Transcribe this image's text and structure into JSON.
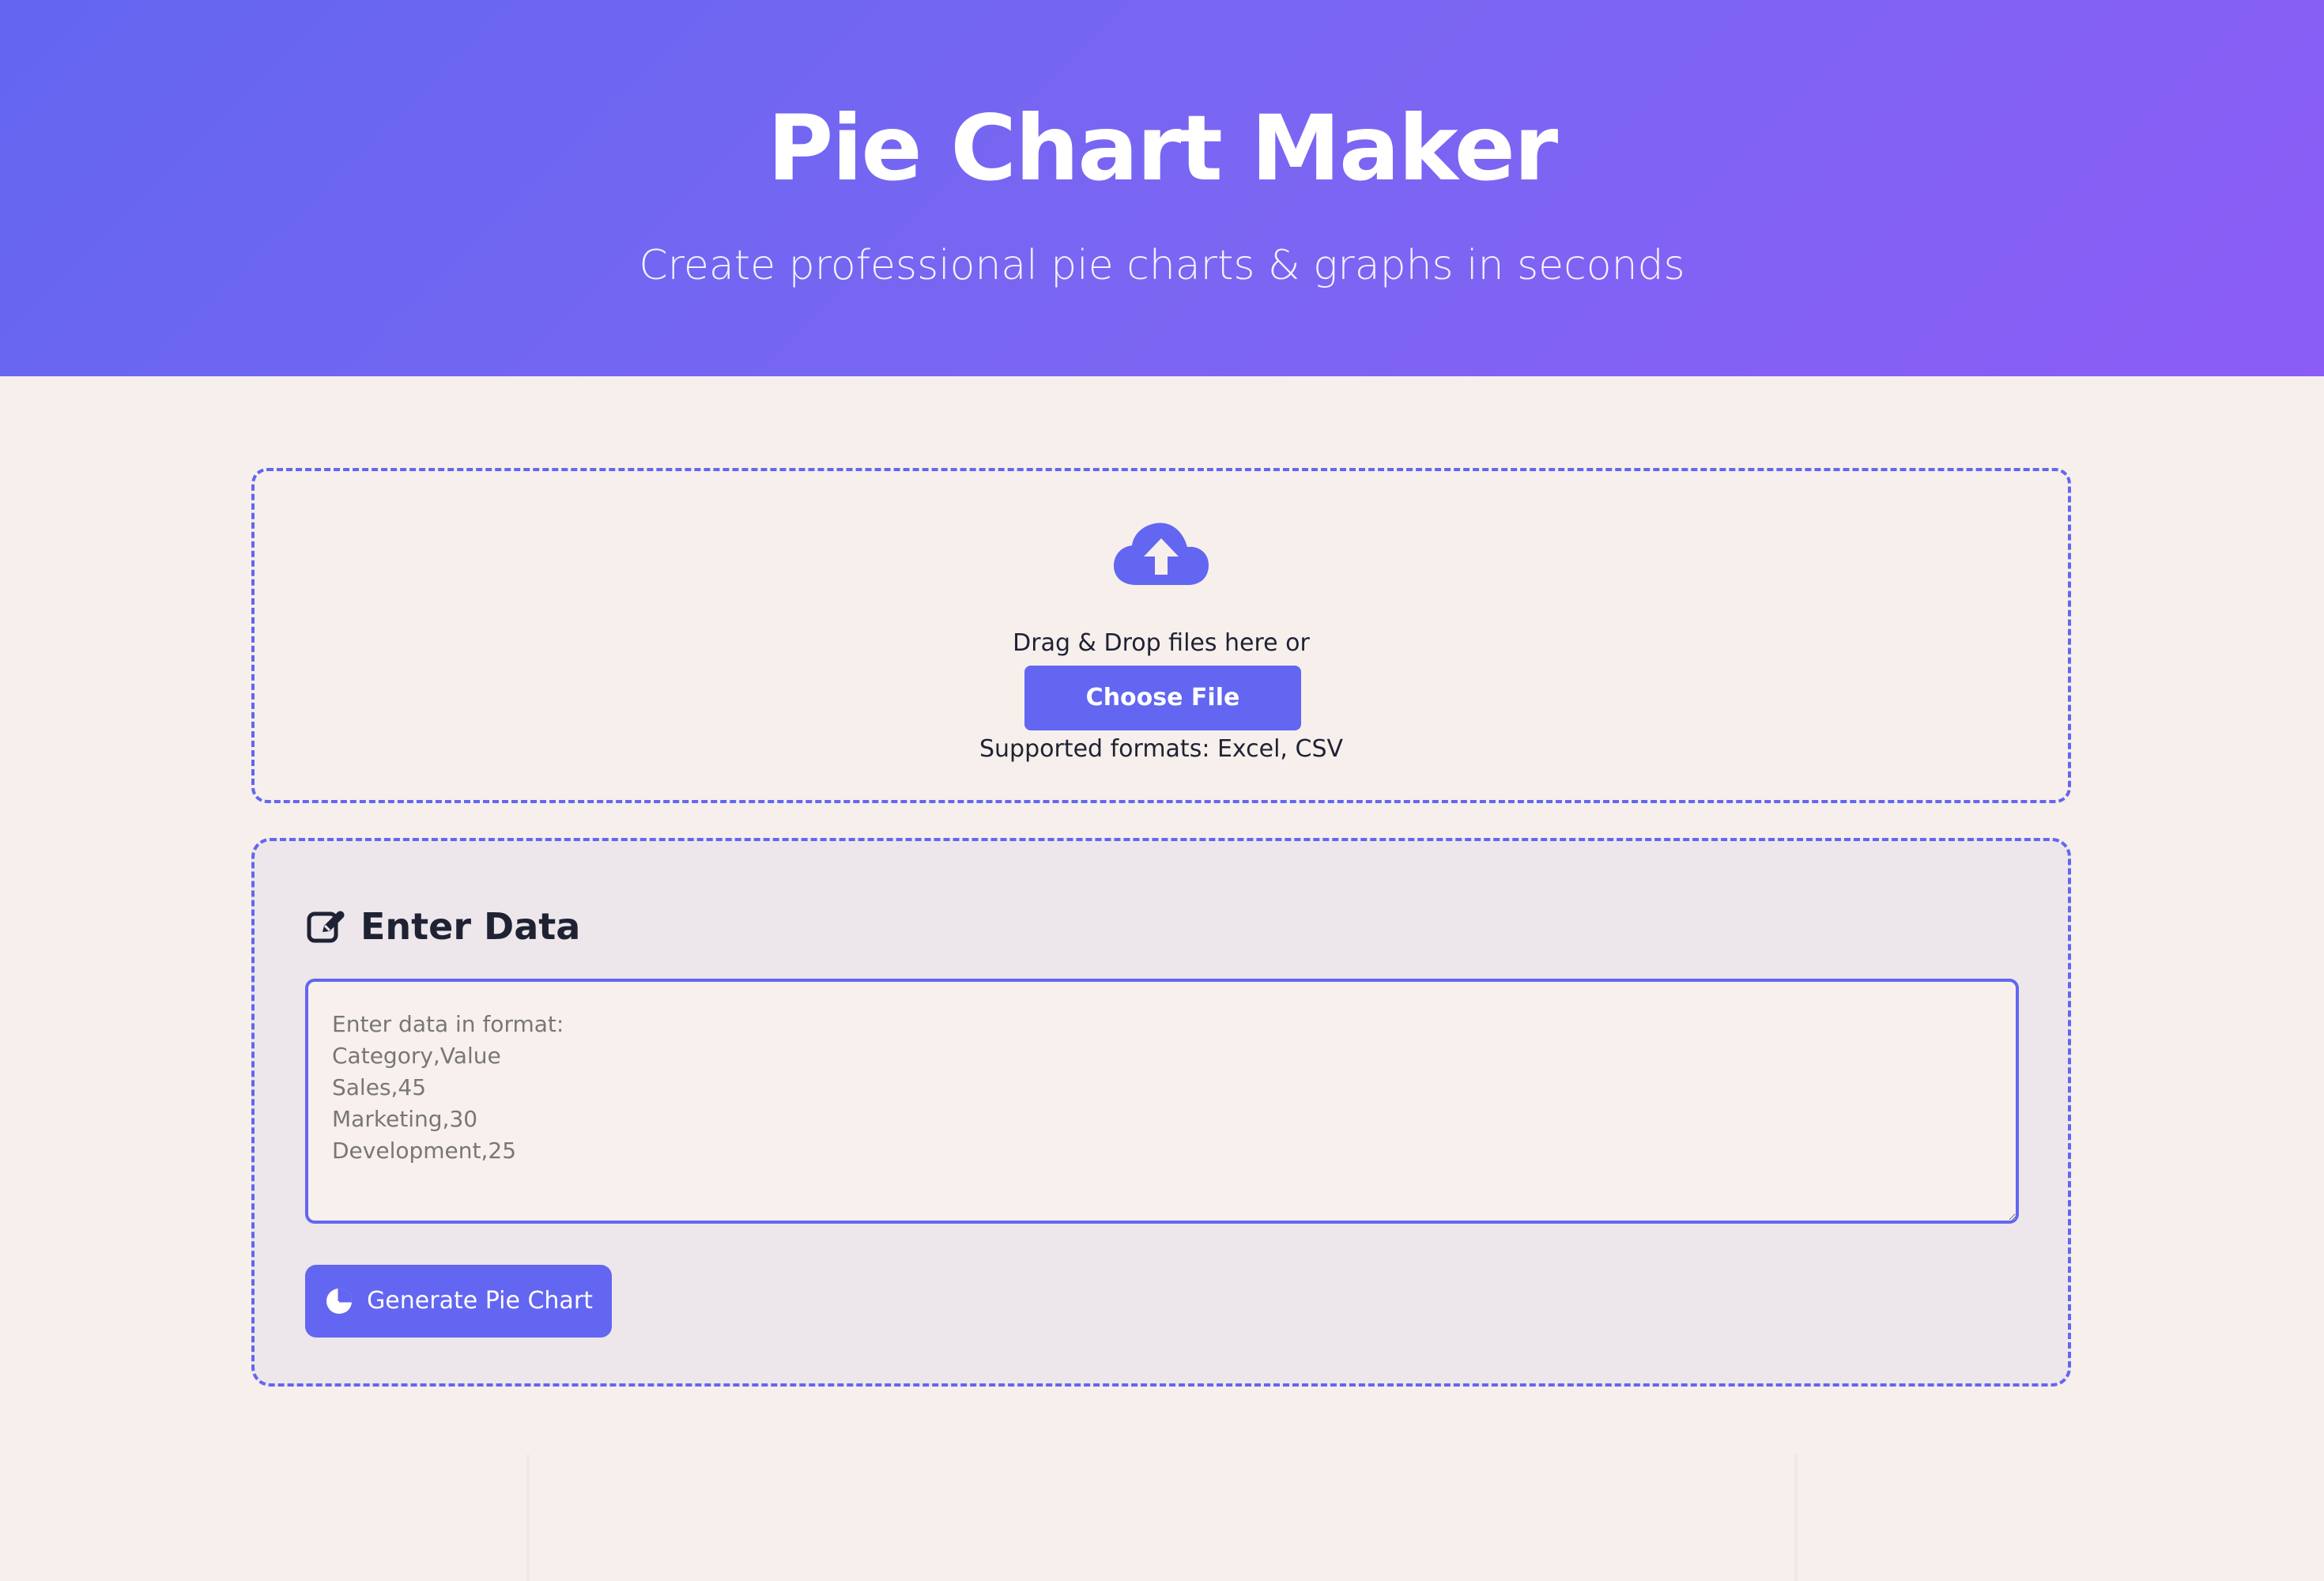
{
  "header": {
    "title": "Pie Chart Maker",
    "subtitle": "Create professional pie charts & graphs in seconds"
  },
  "upload": {
    "drag_text": "Drag & Drop files here or",
    "button_label": "Choose File",
    "supported_formats": "Supported formats: Excel, CSV",
    "icon": "cloud-upload-icon"
  },
  "data_entry": {
    "title": "Enter Data",
    "icon": "edit-icon",
    "textarea_value": "",
    "textarea_placeholder": "Enter data in format:\nCategory,Value\nSales,45\nMarketing,30\nDevelopment,25",
    "generate_button_label": "Generate Pie Chart",
    "generate_icon": "pie-chart-icon"
  },
  "colors": {
    "accent": "#6366f1",
    "accent_purple": "#8b5cf6",
    "background": "#f6efec",
    "card_background": "#ede7ec",
    "text": "#1f2233"
  }
}
